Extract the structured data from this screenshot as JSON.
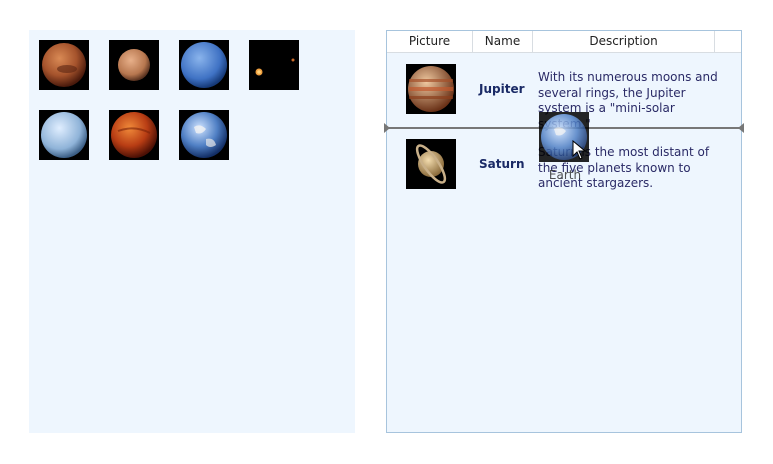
{
  "planets_pool": [
    {
      "icon": "mars-icon"
    },
    {
      "icon": "mercury-icon"
    },
    {
      "icon": "neptune-icon"
    },
    {
      "icon": "pluto-icon"
    },
    {
      "icon": "uranus-icon"
    },
    {
      "icon": "venus-icon"
    },
    {
      "icon": "earth-icon"
    }
  ],
  "table": {
    "headers": [
      "Picture",
      "Name",
      "Description"
    ],
    "rows": [
      {
        "icon": "jupiter-icon",
        "name": "Jupiter",
        "description": "With its numerous moons and several rings, the Jupiter system is a \"mini-solar system.\""
      },
      {
        "icon": "saturn-icon",
        "name": "Saturn",
        "description": "Saturn is the most distant of the five planets known to ancient stargazers."
      }
    ]
  },
  "drag": {
    "label": "Earth",
    "icon": "earth-icon"
  },
  "colors": {
    "panel_bg": "#eef6fe",
    "panel_border": "#a7c4dd",
    "name_text": "#1a2a66",
    "insert_line": "#777777"
  }
}
